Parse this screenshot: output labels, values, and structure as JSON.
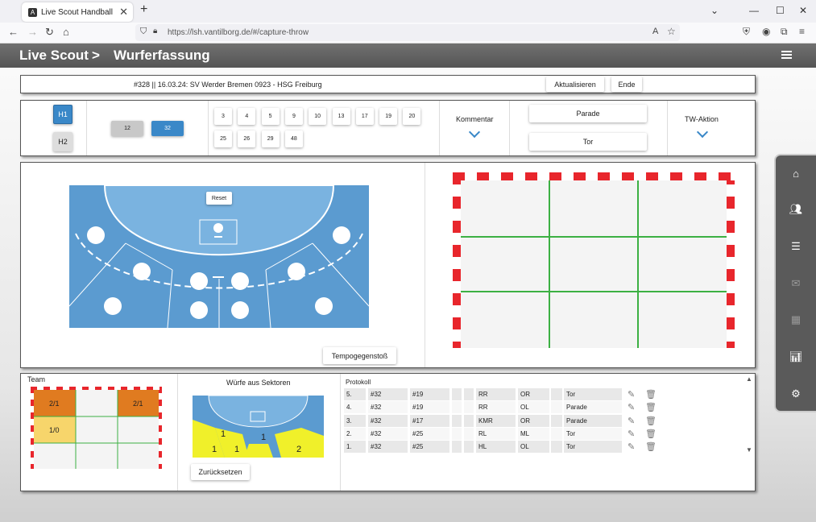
{
  "browser": {
    "tab_title": "Live Scout Handball",
    "url": "https://lsh.vantilborg.de/#/capture-throw",
    "tab_close": "✕",
    "new_tab": "+"
  },
  "header": {
    "app": "Live Scout",
    "separator": ">",
    "page": "Wurferfassung"
  },
  "match": {
    "title": "#328 || 16.03.24: SV Werder Bremen 0923 - HSG Freiburg",
    "refresh_label": "Aktualisieren",
    "end_label": "Ende"
  },
  "controls": {
    "halves": [
      "H1",
      "H2"
    ],
    "goalkeepers": [
      "12",
      "32"
    ],
    "players_row1": [
      "3",
      "4",
      "5",
      "9",
      "10",
      "13",
      "17",
      "19",
      "20"
    ],
    "players_row2": [
      "25",
      "26",
      "29",
      "48"
    ],
    "comment_label": "Kommentar",
    "save_label": "Parade",
    "goal_label": "Tor",
    "gk_action_label": "TW-Aktion"
  },
  "field": {
    "reset_label": "Reset",
    "fastbreak_label": "Tempogegenstoß"
  },
  "team_panel": {
    "title": "Team",
    "cells": [
      "2/1",
      "",
      "2/1",
      "1/0",
      "",
      "",
      "",
      "",
      ""
    ]
  },
  "sectors_panel": {
    "title": "Würfe aus Sektoren",
    "values": [
      "1",
      "1",
      "1",
      "1",
      "2"
    ],
    "reset_label": "Zurücksetzen"
  },
  "protocol": {
    "title": "Protokoll",
    "rows": [
      {
        "nr": "5.",
        "gk": "#32",
        "player": "#19",
        "pos": "RR",
        "zone": "OR",
        "result": "Tor"
      },
      {
        "nr": "4.",
        "gk": "#32",
        "player": "#19",
        "pos": "RR",
        "zone": "OL",
        "result": "Parade"
      },
      {
        "nr": "3.",
        "gk": "#32",
        "player": "#17",
        "pos": "KMR",
        "zone": "OR",
        "result": "Parade"
      },
      {
        "nr": "2.",
        "gk": "#32",
        "player": "#25",
        "pos": "RL",
        "zone": "ML",
        "result": "Tor"
      },
      {
        "nr": "1.",
        "gk": "#32",
        "player": "#25",
        "pos": "HL",
        "zone": "OL",
        "result": "Tor"
      }
    ]
  },
  "colors": {
    "accent": "#3a88c8",
    "court": "#5b9bd0",
    "court_light": "#7ab3e0",
    "goal_red": "#e8262c",
    "grid_green": "#3cb043",
    "cell_orange": "#e07b20",
    "cell_yellow": "#f7d56b",
    "sector_yellow": "#f0f02a"
  }
}
